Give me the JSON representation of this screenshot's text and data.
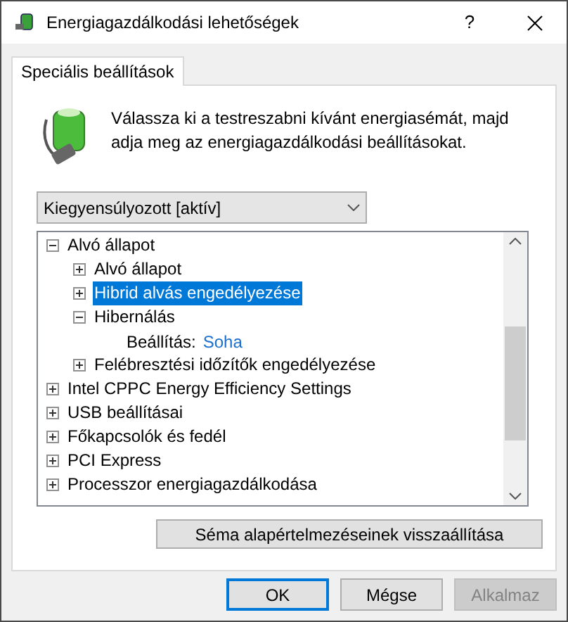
{
  "window": {
    "title": "Energiagazdálkodási lehetőségek",
    "help": "?"
  },
  "tabs": [
    {
      "label": "Speciális beállítások",
      "selected": true
    }
  ],
  "description": "Válassza ki a testreszabni kívánt energiasémát, majd adja meg az energiagazdálkodási beállításokat.",
  "plan_dropdown": {
    "value": "Kiegyensúlyozott [aktív]"
  },
  "tree": [
    {
      "kind": "node",
      "label": "Alvó állapot",
      "expanded": true,
      "selected": false,
      "children": [
        {
          "kind": "node",
          "label": "Alvó állapot",
          "expanded": false,
          "selected": false
        },
        {
          "kind": "node",
          "label": "Hibrid alvás engedélyezése",
          "expanded": false,
          "selected": true
        },
        {
          "kind": "node",
          "label": "Hibernálás",
          "expanded": true,
          "selected": false,
          "children": [
            {
              "kind": "setting",
              "label": "Beállítás:",
              "value": "Soha"
            }
          ]
        },
        {
          "kind": "node",
          "label": "Felébresztési időzítők engedélyezése",
          "expanded": false,
          "selected": false
        }
      ]
    },
    {
      "kind": "node",
      "label": "Intel CPPC Energy Efficiency Settings",
      "expanded": false,
      "selected": false
    },
    {
      "kind": "node",
      "label": "USB beállításai",
      "expanded": false,
      "selected": false
    },
    {
      "kind": "node",
      "label": "Főkapcsolók és fedél",
      "expanded": false,
      "selected": false
    },
    {
      "kind": "node",
      "label": "PCI Express",
      "expanded": false,
      "selected": false
    },
    {
      "kind": "node",
      "label": "Processzor energiagazdálkodása",
      "expanded": false,
      "selected": false
    }
  ],
  "reset_button": "Séma alapértelmezéseinek visszaállítása",
  "buttons": [
    {
      "label": "OK",
      "default": true,
      "disabled": false
    },
    {
      "label": "Mégse",
      "default": false,
      "disabled": false
    },
    {
      "label": "Alkalmaz",
      "default": false,
      "disabled": true
    }
  ]
}
